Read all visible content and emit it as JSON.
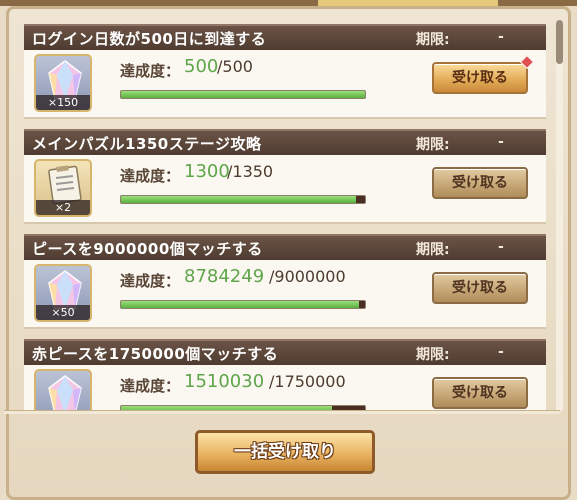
{
  "common": {
    "deadline_label": "期限:",
    "deadline_value": "-",
    "progress_label": "達成度：",
    "claim_label": "受け取る",
    "claim_all_label": "一括受け取り"
  },
  "missions": [
    {
      "title": "ログイン日数が500日に到達する",
      "reward_icon": "rainbow-crystal-icon",
      "reward_count": "×150",
      "progress_current": "500",
      "progress_total": "/500",
      "progress_fraction": 1.0,
      "claimable": true,
      "has_notification": true
    },
    {
      "title": "メインパズル1350ステージ攻略",
      "reward_icon": "clipboard-ticket-icon",
      "reward_count": "×2",
      "progress_current": "1300",
      "progress_total": "/1350",
      "progress_fraction": 0.963,
      "claimable": false,
      "has_notification": false
    },
    {
      "title": "ピースを9000000個マッチする",
      "reward_icon": "rainbow-crystal-icon",
      "reward_count": "×50",
      "progress_current": "8784249",
      "progress_total": "/9000000",
      "progress_fraction": 0.976,
      "claimable": false,
      "has_notification": false
    },
    {
      "title": "赤ピースを1750000個マッチする",
      "reward_icon": "rainbow-crystal-icon",
      "reward_count": "",
      "progress_current": "1510030",
      "progress_total": "/1750000",
      "progress_fraction": 0.863,
      "claimable": false,
      "has_notification": false
    }
  ],
  "colors": {
    "progress_green": "#5fa54a",
    "header_brown": "#5a4538",
    "button_gold": "#e4ad5a"
  }
}
